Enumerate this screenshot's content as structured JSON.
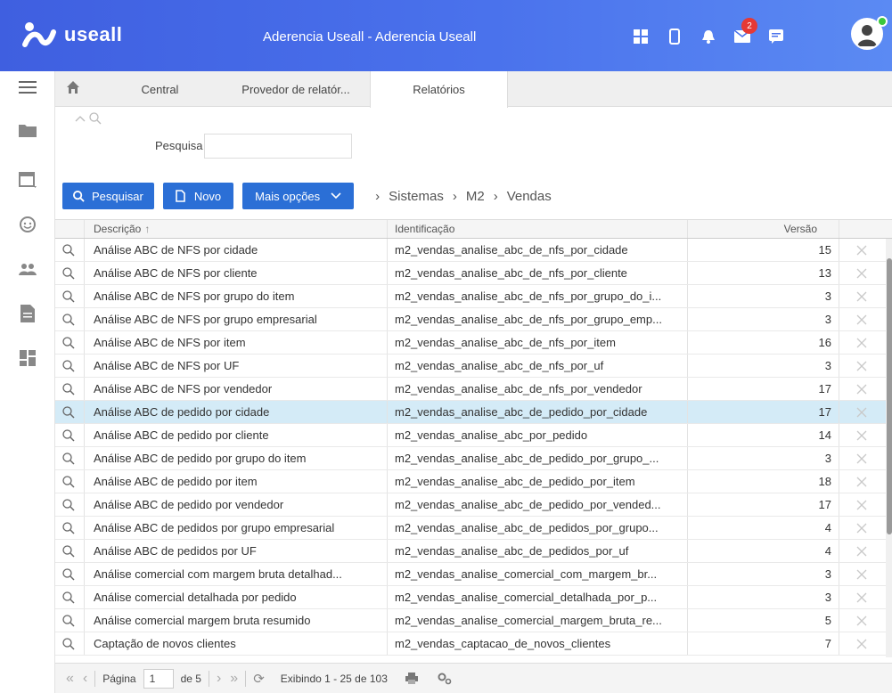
{
  "app": {
    "logo_text": "useall",
    "title": "Aderencia Useall - Aderencia Useall",
    "notifications_count": "2"
  },
  "tabs": [
    {
      "label": "Central"
    },
    {
      "label": "Provedor de relatór..."
    },
    {
      "label": "Relatórios"
    }
  ],
  "search": {
    "label": "Pesquisa",
    "value": "",
    "placeholder": ""
  },
  "toolbar": {
    "search_label": "Pesquisar",
    "new_label": "Novo",
    "more_label": "Mais opções"
  },
  "breadcrumb": [
    "Sistemas",
    "M2",
    "Vendas"
  ],
  "table": {
    "headers": {
      "desc": "Descrição",
      "id": "Identificação",
      "ver": "Versão"
    },
    "rows": [
      {
        "desc": "Análise ABC de NFS por cidade",
        "id": "m2_vendas_analise_abc_de_nfs_por_cidade",
        "ver": "15"
      },
      {
        "desc": "Análise ABC de NFS por cliente",
        "id": "m2_vendas_analise_abc_de_nfs_por_cliente",
        "ver": "13"
      },
      {
        "desc": "Análise ABC de NFS por grupo do item",
        "id": "m2_vendas_analise_abc_de_nfs_por_grupo_do_i...",
        "ver": "3"
      },
      {
        "desc": "Análise ABC de NFS por grupo empresarial",
        "id": "m2_vendas_analise_abc_de_nfs_por_grupo_emp...",
        "ver": "3"
      },
      {
        "desc": "Análise ABC de NFS por item",
        "id": "m2_vendas_analise_abc_de_nfs_por_item",
        "ver": "16"
      },
      {
        "desc": "Análise ABC de NFS por UF",
        "id": "m2_vendas_analise_abc_de_nfs_por_uf",
        "ver": "3"
      },
      {
        "desc": "Análise ABC de NFS por vendedor",
        "id": "m2_vendas_analise_abc_de_nfs_por_vendedor",
        "ver": "17"
      },
      {
        "desc": "Análise ABC de pedido por cidade",
        "id": "m2_vendas_analise_abc_de_pedido_por_cidade",
        "ver": "17"
      },
      {
        "desc": "Análise ABC de pedido por cliente",
        "id": "m2_vendas_analise_abc_por_pedido",
        "ver": "14"
      },
      {
        "desc": "Análise ABC de pedido por grupo do item",
        "id": "m2_vendas_analise_abc_de_pedido_por_grupo_...",
        "ver": "3"
      },
      {
        "desc": "Análise ABC de pedido por item",
        "id": "m2_vendas_analise_abc_de_pedido_por_item",
        "ver": "18"
      },
      {
        "desc": "Análise ABC de pedido por vendedor",
        "id": "m2_vendas_analise_abc_de_pedido_por_vended...",
        "ver": "17"
      },
      {
        "desc": "Análise ABC de pedidos por grupo empresarial",
        "id": "m2_vendas_analise_abc_de_pedidos_por_grupo...",
        "ver": "4"
      },
      {
        "desc": "Análise ABC de pedidos por UF",
        "id": "m2_vendas_analise_abc_de_pedidos_por_uf",
        "ver": "4"
      },
      {
        "desc": "Análise comercial com margem bruta detalhad...",
        "id": "m2_vendas_analise_comercial_com_margem_br...",
        "ver": "3"
      },
      {
        "desc": "Análise comercial detalhada por pedido",
        "id": "m2_vendas_analise_comercial_detalhada_por_p...",
        "ver": "3"
      },
      {
        "desc": "Análise comercial margem bruta resumido",
        "id": "m2_vendas_analise_comercial_margem_bruta_re...",
        "ver": "5"
      },
      {
        "desc": "Captação de novos clientes",
        "id": "m2_vendas_captacao_de_novos_clientes",
        "ver": "7"
      }
    ]
  },
  "pager": {
    "page_label": "Página",
    "page_value": "1",
    "of_label": "de 5",
    "showing": "Exibindo 1 - 25 de 103"
  },
  "colors": {
    "header_start": "#3f5fe0",
    "header_end": "#5b8af3",
    "button": "#2b6fd6",
    "selected_row": "#d4ebf7",
    "badge": "#e53935"
  }
}
